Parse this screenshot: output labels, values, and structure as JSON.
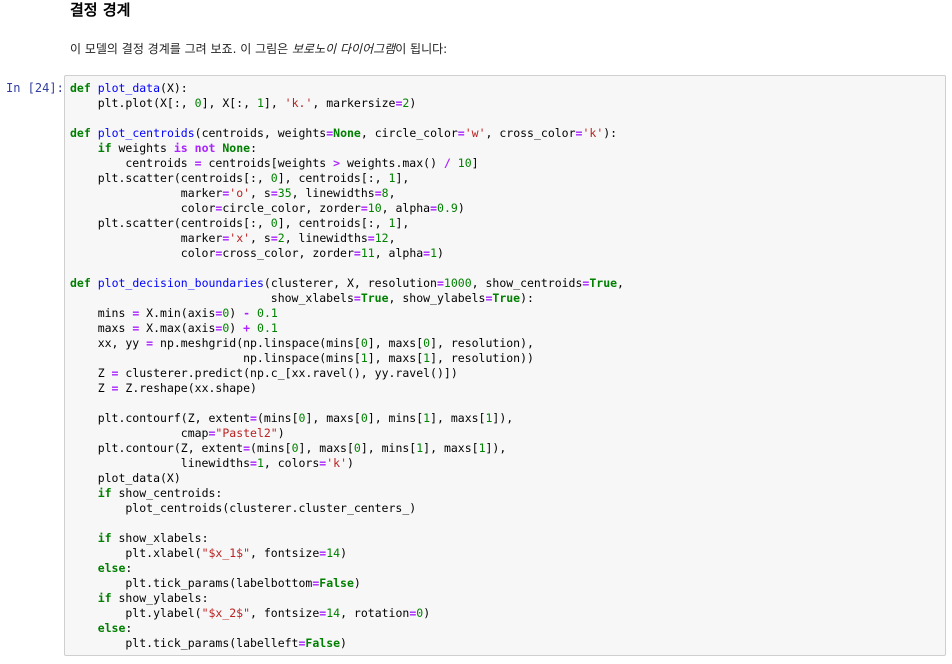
{
  "markdown": {
    "heading": "결정 경계",
    "para_before": "이 모델의 결정 경계를 그려 보죠. 이 그림은 ",
    "para_emphasis": "보로노이 다이어그램",
    "para_after": "이 됩니다:"
  },
  "cell": {
    "prompt": "In [24]:",
    "lines": [
      [
        [
          "kw",
          "def"
        ],
        [
          "p",
          " "
        ],
        [
          "fn",
          "plot_data"
        ],
        [
          "p",
          "(X):"
        ]
      ],
      [
        [
          "p",
          "    plt.plot(X[:, "
        ],
        [
          "num",
          "0"
        ],
        [
          "p",
          "], X[:, "
        ],
        [
          "num",
          "1"
        ],
        [
          "p",
          "], "
        ],
        [
          "str",
          "'k.'"
        ],
        [
          "p",
          ", markersize"
        ],
        [
          "op",
          "="
        ],
        [
          "num",
          "2"
        ],
        [
          "p",
          ")"
        ]
      ],
      [],
      [
        [
          "kw",
          "def"
        ],
        [
          "p",
          " "
        ],
        [
          "fn",
          "plot_centroids"
        ],
        [
          "p",
          "(centroids, weights"
        ],
        [
          "op",
          "="
        ],
        [
          "kw",
          "None"
        ],
        [
          "p",
          ", circle_color"
        ],
        [
          "op",
          "="
        ],
        [
          "str",
          "'w'"
        ],
        [
          "p",
          ", cross_color"
        ],
        [
          "op",
          "="
        ],
        [
          "str",
          "'k'"
        ],
        [
          "p",
          "):"
        ]
      ],
      [
        [
          "p",
          "    "
        ],
        [
          "kw",
          "if"
        ],
        [
          "p",
          " weights "
        ],
        [
          "op",
          "is not"
        ],
        [
          "p",
          " "
        ],
        [
          "kw",
          "None"
        ],
        [
          "p",
          ":"
        ]
      ],
      [
        [
          "p",
          "        centroids "
        ],
        [
          "op",
          "="
        ],
        [
          "p",
          " centroids[weights "
        ],
        [
          "op",
          ">"
        ],
        [
          "p",
          " weights.max() "
        ],
        [
          "op",
          "/"
        ],
        [
          "p",
          " "
        ],
        [
          "num",
          "10"
        ],
        [
          "p",
          "]"
        ]
      ],
      [
        [
          "p",
          "    plt.scatter(centroids[:, "
        ],
        [
          "num",
          "0"
        ],
        [
          "p",
          "], centroids[:, "
        ],
        [
          "num",
          "1"
        ],
        [
          "p",
          "],"
        ]
      ],
      [
        [
          "p",
          "                marker"
        ],
        [
          "op",
          "="
        ],
        [
          "str",
          "'o'"
        ],
        [
          "p",
          ", s"
        ],
        [
          "op",
          "="
        ],
        [
          "num",
          "35"
        ],
        [
          "p",
          ", linewidths"
        ],
        [
          "op",
          "="
        ],
        [
          "num",
          "8"
        ],
        [
          "p",
          ","
        ]
      ],
      [
        [
          "p",
          "                color"
        ],
        [
          "op",
          "="
        ],
        [
          "p",
          "circle_color, zorder"
        ],
        [
          "op",
          "="
        ],
        [
          "num",
          "10"
        ],
        [
          "p",
          ", alpha"
        ],
        [
          "op",
          "="
        ],
        [
          "num",
          "0.9"
        ],
        [
          "p",
          ")"
        ]
      ],
      [
        [
          "p",
          "    plt.scatter(centroids[:, "
        ],
        [
          "num",
          "0"
        ],
        [
          "p",
          "], centroids[:, "
        ],
        [
          "num",
          "1"
        ],
        [
          "p",
          "],"
        ]
      ],
      [
        [
          "p",
          "                marker"
        ],
        [
          "op",
          "="
        ],
        [
          "str",
          "'x'"
        ],
        [
          "p",
          ", s"
        ],
        [
          "op",
          "="
        ],
        [
          "num",
          "2"
        ],
        [
          "p",
          ", linewidths"
        ],
        [
          "op",
          "="
        ],
        [
          "num",
          "12"
        ],
        [
          "p",
          ","
        ]
      ],
      [
        [
          "p",
          "                color"
        ],
        [
          "op",
          "="
        ],
        [
          "p",
          "cross_color, zorder"
        ],
        [
          "op",
          "="
        ],
        [
          "num",
          "11"
        ],
        [
          "p",
          ", alpha"
        ],
        [
          "op",
          "="
        ],
        [
          "num",
          "1"
        ],
        [
          "p",
          ")"
        ]
      ],
      [],
      [
        [
          "kw",
          "def"
        ],
        [
          "p",
          " "
        ],
        [
          "fn",
          "plot_decision_boundaries"
        ],
        [
          "p",
          "(clusterer, X, resolution"
        ],
        [
          "op",
          "="
        ],
        [
          "num",
          "1000"
        ],
        [
          "p",
          ", show_centroids"
        ],
        [
          "op",
          "="
        ],
        [
          "kw",
          "True"
        ],
        [
          "p",
          ","
        ]
      ],
      [
        [
          "p",
          "                             show_xlabels"
        ],
        [
          "op",
          "="
        ],
        [
          "kw",
          "True"
        ],
        [
          "p",
          ", show_ylabels"
        ],
        [
          "op",
          "="
        ],
        [
          "kw",
          "True"
        ],
        [
          "p",
          "):"
        ]
      ],
      [
        [
          "p",
          "    mins "
        ],
        [
          "op",
          "="
        ],
        [
          "p",
          " X.min(axis"
        ],
        [
          "op",
          "="
        ],
        [
          "num",
          "0"
        ],
        [
          "p",
          ") "
        ],
        [
          "op",
          "-"
        ],
        [
          "p",
          " "
        ],
        [
          "num",
          "0.1"
        ]
      ],
      [
        [
          "p",
          "    maxs "
        ],
        [
          "op",
          "="
        ],
        [
          "p",
          " X.max(axis"
        ],
        [
          "op",
          "="
        ],
        [
          "num",
          "0"
        ],
        [
          "p",
          ") "
        ],
        [
          "op",
          "+"
        ],
        [
          "p",
          " "
        ],
        [
          "num",
          "0.1"
        ]
      ],
      [
        [
          "p",
          "    xx, yy "
        ],
        [
          "op",
          "="
        ],
        [
          "p",
          " np.meshgrid(np.linspace(mins["
        ],
        [
          "num",
          "0"
        ],
        [
          "p",
          "], maxs["
        ],
        [
          "num",
          "0"
        ],
        [
          "p",
          "], resolution),"
        ]
      ],
      [
        [
          "p",
          "                         np.linspace(mins["
        ],
        [
          "num",
          "1"
        ],
        [
          "p",
          "], maxs["
        ],
        [
          "num",
          "1"
        ],
        [
          "p",
          "], resolution))"
        ]
      ],
      [
        [
          "p",
          "    Z "
        ],
        [
          "op",
          "="
        ],
        [
          "p",
          " clusterer.predict(np.c_[xx.ravel(), yy.ravel()])"
        ]
      ],
      [
        [
          "p",
          "    Z "
        ],
        [
          "op",
          "="
        ],
        [
          "p",
          " Z.reshape(xx.shape)"
        ]
      ],
      [],
      [
        [
          "p",
          "    plt.contourf(Z, extent"
        ],
        [
          "op",
          "="
        ],
        [
          "p",
          "(mins["
        ],
        [
          "num",
          "0"
        ],
        [
          "p",
          "], maxs["
        ],
        [
          "num",
          "0"
        ],
        [
          "p",
          "], mins["
        ],
        [
          "num",
          "1"
        ],
        [
          "p",
          "], maxs["
        ],
        [
          "num",
          "1"
        ],
        [
          "p",
          "]),"
        ]
      ],
      [
        [
          "p",
          "                cmap"
        ],
        [
          "op",
          "="
        ],
        [
          "str",
          "\"Pastel2\""
        ],
        [
          "p",
          ")"
        ]
      ],
      [
        [
          "p",
          "    plt.contour(Z, extent"
        ],
        [
          "op",
          "="
        ],
        [
          "p",
          "(mins["
        ],
        [
          "num",
          "0"
        ],
        [
          "p",
          "], maxs["
        ],
        [
          "num",
          "0"
        ],
        [
          "p",
          "], mins["
        ],
        [
          "num",
          "1"
        ],
        [
          "p",
          "], maxs["
        ],
        [
          "num",
          "1"
        ],
        [
          "p",
          "]),"
        ]
      ],
      [
        [
          "p",
          "                linewidths"
        ],
        [
          "op",
          "="
        ],
        [
          "num",
          "1"
        ],
        [
          "p",
          ", colors"
        ],
        [
          "op",
          "="
        ],
        [
          "str",
          "'k'"
        ],
        [
          "p",
          ")"
        ]
      ],
      [
        [
          "p",
          "    plot_data(X)"
        ]
      ],
      [
        [
          "p",
          "    "
        ],
        [
          "kw",
          "if"
        ],
        [
          "p",
          " show_centroids:"
        ]
      ],
      [
        [
          "p",
          "        plot_centroids(clusterer.cluster_centers_)"
        ]
      ],
      [],
      [
        [
          "p",
          "    "
        ],
        [
          "kw",
          "if"
        ],
        [
          "p",
          " show_xlabels:"
        ]
      ],
      [
        [
          "p",
          "        plt.xlabel("
        ],
        [
          "str",
          "\"$x_1$\""
        ],
        [
          "p",
          ", fontsize"
        ],
        [
          "op",
          "="
        ],
        [
          "num",
          "14"
        ],
        [
          "p",
          ")"
        ]
      ],
      [
        [
          "p",
          "    "
        ],
        [
          "kw",
          "else"
        ],
        [
          "p",
          ":"
        ]
      ],
      [
        [
          "p",
          "        plt.tick_params(labelbottom"
        ],
        [
          "op",
          "="
        ],
        [
          "kw",
          "False"
        ],
        [
          "p",
          ")"
        ]
      ],
      [
        [
          "p",
          "    "
        ],
        [
          "kw",
          "if"
        ],
        [
          "p",
          " show_ylabels:"
        ]
      ],
      [
        [
          "p",
          "        plt.ylabel("
        ],
        [
          "str",
          "\"$x_2$\""
        ],
        [
          "p",
          ", fontsize"
        ],
        [
          "op",
          "="
        ],
        [
          "num",
          "14"
        ],
        [
          "p",
          ", rotation"
        ],
        [
          "op",
          "="
        ],
        [
          "num",
          "0"
        ],
        [
          "p",
          ")"
        ]
      ],
      [
        [
          "p",
          "    "
        ],
        [
          "kw",
          "else"
        ],
        [
          "p",
          ":"
        ]
      ],
      [
        [
          "p",
          "        plt.tick_params(labelleft"
        ],
        [
          "op",
          "="
        ],
        [
          "kw",
          "False"
        ],
        [
          "p",
          ")"
        ]
      ]
    ]
  }
}
